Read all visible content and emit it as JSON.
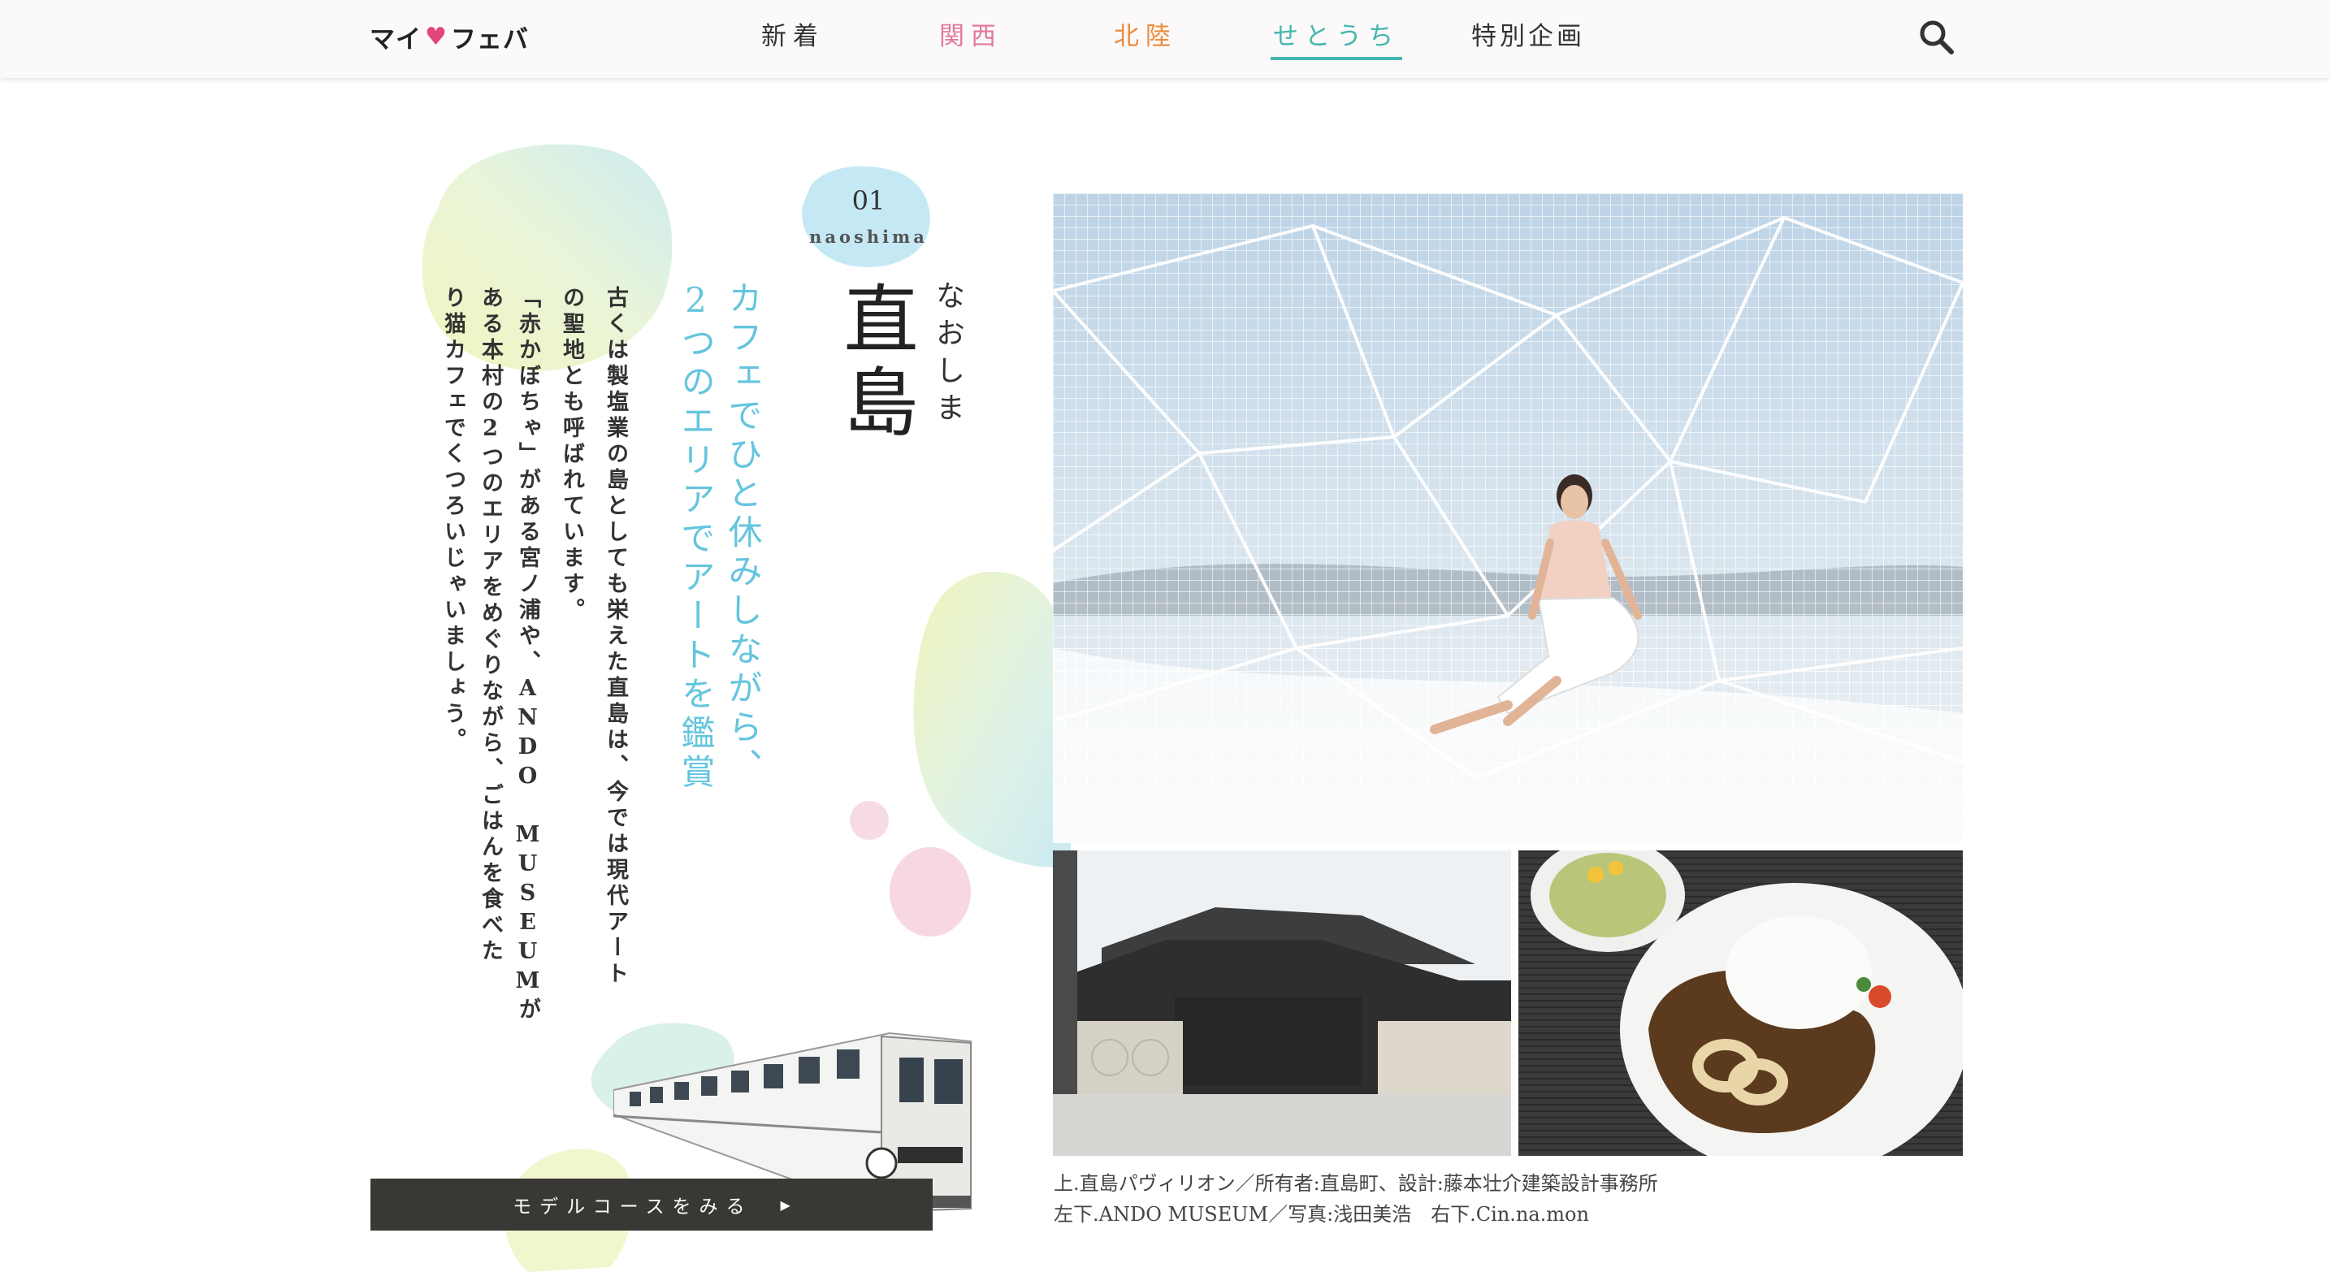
{
  "header": {
    "logo": {
      "left": "マイ",
      "heart": "♥",
      "right": "フェバ"
    },
    "tabs": [
      {
        "label": "新着",
        "color": "#333333",
        "active": false
      },
      {
        "label": "関西",
        "color": "#e07a9a",
        "active": false
      },
      {
        "label": "北陸",
        "color": "#ee8a3a",
        "active": false
      },
      {
        "label": "せとうち",
        "color": "#45b7b0",
        "active": true
      },
      {
        "label": "特別企画",
        "color": "#333333",
        "active": false
      }
    ],
    "search_icon": "search-icon"
  },
  "article": {
    "number": "01",
    "roman": "naoshima",
    "title": "直島",
    "reading": "なおしま",
    "catch_lines": [
      "カフェでひと休みしながら、",
      "2つのエリアでアートを鑑賞"
    ],
    "body_lines": [
      "古くは製塩業の島としても栄えた直島は、今では現代アート",
      "の聖地とも呼ばれています。",
      "「赤かぼちゃ」がある宮ノ浦や、ANDO MUSEUMが",
      "ある本村の2つのエリアをめぐりながら、ごはんを食べた",
      "り猫カフェでくつろいじゃいましょう。"
    ],
    "course_button": {
      "label": "モデルコースをみる",
      "arrow": "▶"
    },
    "captions": [
      "上.直島パヴィリオン／所有者:直島町、設計:藤本壮介建築設計事務所",
      "左下.ANDO MUSEUM／写真:浅田美浩　右下.Cin.na.mon"
    ]
  },
  "colors": {
    "accent_teal": "#45b7b0",
    "catch_blue": "#64c5de",
    "button_bg": "#3a3835"
  }
}
